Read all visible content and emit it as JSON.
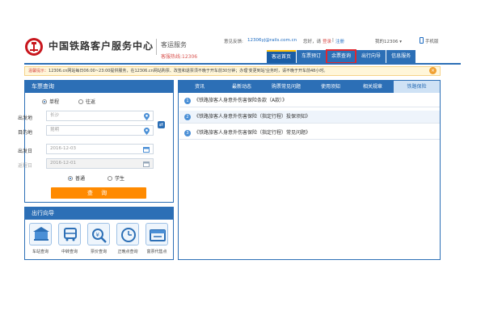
{
  "header": {
    "brand": "中国铁路客户服务中心",
    "service_name": "客运服务",
    "hotline": "客服热线:12306",
    "feedback_label": "意见反馈:",
    "feedback_email": "12306yj@rails.com.cn",
    "welcome": "您好，请",
    "login": "登录",
    "register": "注册",
    "my12306": "我的12306",
    "mobile": "手机版"
  },
  "nav": {
    "items": [
      {
        "label": "客运首页"
      },
      {
        "label": "车票预订"
      },
      {
        "label": "余票查询"
      },
      {
        "label": "出行向导"
      },
      {
        "label": "信息服务"
      }
    ]
  },
  "notice": {
    "label": "温馨提示：",
    "text": "12306.cn网站每日06:00~23:00提供服务，在12306.cn网站购票、改签和退票须不晚于开车前30分钟；办理'变更到站'业务时，请不晚于开车前48小时。"
  },
  "booking": {
    "title": "车票查询",
    "trip_types": [
      "单程",
      "往返"
    ],
    "from_label": "出发地",
    "from_placeholder": "长沙",
    "to_label": "目的地",
    "to_placeholder": "昆明",
    "depart_label": "出发日",
    "depart_value": "2016-12-03",
    "return_label": "返程日",
    "return_value": "2016-12-01",
    "ticket_types": [
      "普通",
      "学生"
    ],
    "query_label": "查 询"
  },
  "guide": {
    "title": "出行向导",
    "items": [
      {
        "label": "车站查询",
        "icon": "station-icon"
      },
      {
        "label": "中转查询",
        "icon": "transfer-icon"
      },
      {
        "label": "票价查询",
        "icon": "price-icon"
      },
      {
        "label": "正晚点查询",
        "icon": "clock-icon"
      },
      {
        "label": "富票代售点",
        "icon": "agency-icon"
      }
    ]
  },
  "info": {
    "tabs": [
      {
        "label": "资讯"
      },
      {
        "label": "最新动态"
      },
      {
        "label": "购票常见问题"
      },
      {
        "label": "使用须知"
      },
      {
        "label": "相关规章"
      },
      {
        "label": "铁路保险"
      }
    ],
    "rows": [
      {
        "num": "1",
        "text": "《铁路旅客人身意外伤害保险条款（A款）》"
      },
      {
        "num": "2",
        "text": "《铁路旅客人身意外伤害保险（指定行程）投保须知》"
      },
      {
        "num": "3",
        "text": "《铁路旅客人身意外伤害保险（指定行程）常见问题》"
      }
    ]
  },
  "colors": {
    "primary": "#2c6fb6",
    "accent": "#ff8a00",
    "highlight": "#e0262e"
  }
}
